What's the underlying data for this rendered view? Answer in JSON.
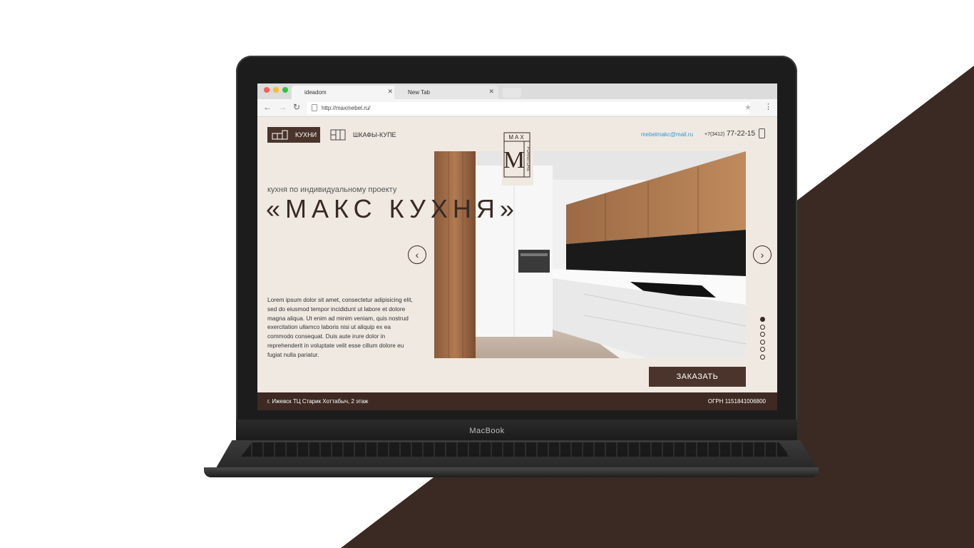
{
  "device": {
    "brand_label": "MacBook"
  },
  "browser": {
    "tabs": [
      {
        "label": "ideadom",
        "active": true
      },
      {
        "label": "New Tab",
        "active": false
      }
    ],
    "url": "http://maxmebel.ru/"
  },
  "site": {
    "nav": {
      "kitchens_label": "КУХНИ",
      "wardrobes_label": "ШКАФЫ-КУПЕ"
    },
    "logo": {
      "top_text": "MAX",
      "letter": "M",
      "bottom_text": "FURNITURE"
    },
    "contacts": {
      "email": "mebelmakc@mail.ru",
      "phone_code": "+7(3412)",
      "phone_number": "77-22-15"
    },
    "hero": {
      "subtitle": "кухня по индивидуальному проекту",
      "headline": "«МАКС КУХНЯ»",
      "body": "Lorem ipsum dolor sit amet, consectetur adipisicing elit, sed do eiusmod tempor incididunt ut labore et dolore magna aliqua. Ut enim ad minim veniam, quis nostrud exercitation ullamco laboris nisi ut aliquip ex ea commodo consequat. Duis aute irure dolor in reprehenderit in voluptate velit esse cillum dolore eu fugiat nulla pariatur.",
      "order_button": "ЗАКАЗАТЬ",
      "slide_count": 6,
      "active_slide": 1
    },
    "footer": {
      "address": "г. Ижевск ТЦ Старик Хоттабыч, 2 этаж",
      "ogrn": "ОГРН 1151841006800"
    },
    "colors": {
      "brand_brown": "#4a342b",
      "page_background": "#efe9e2",
      "email_blue": "#2d9ad6"
    }
  }
}
